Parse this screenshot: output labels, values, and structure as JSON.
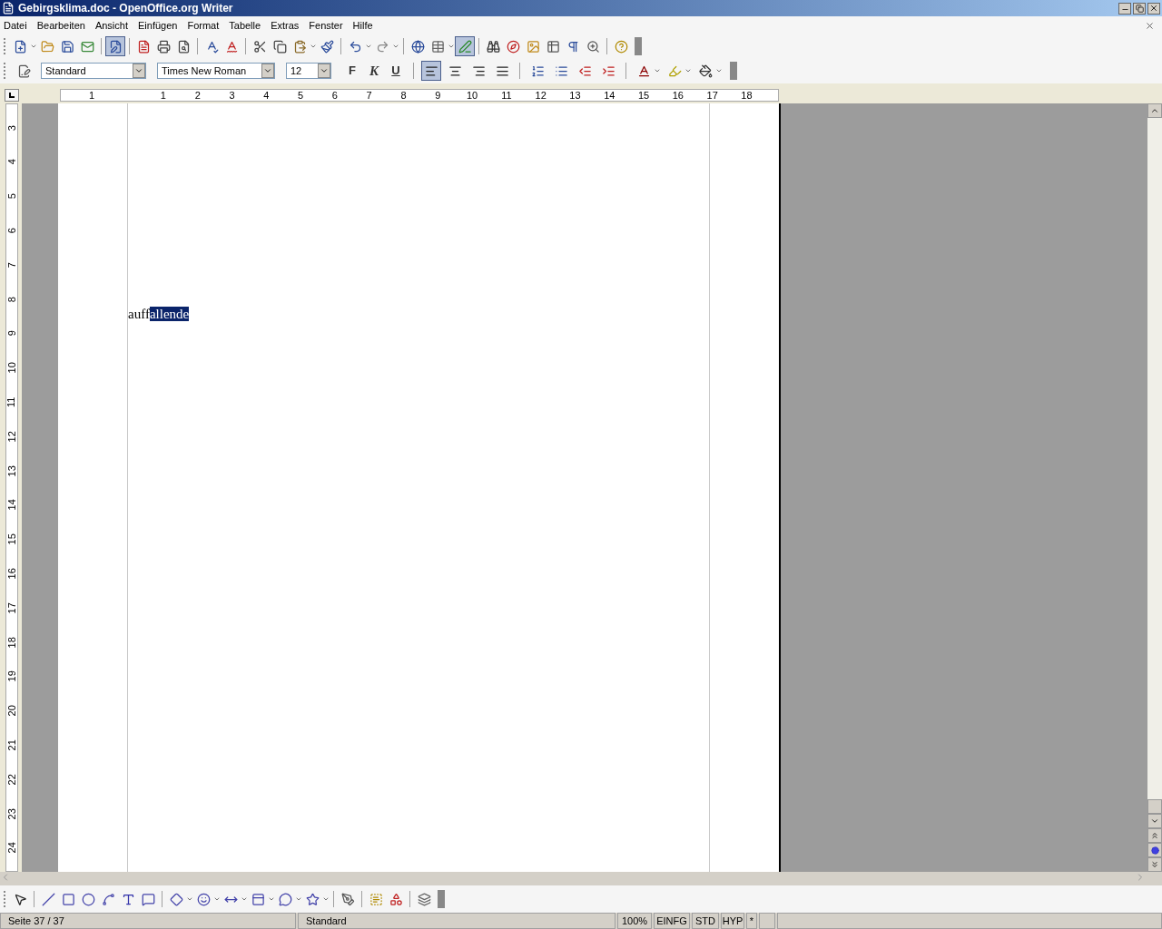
{
  "window": {
    "title": "Gebirgsklima.doc - OpenOffice.org Writer"
  },
  "menu": [
    "Datei",
    "Bearbeiten",
    "Ansicht",
    "Einfügen",
    "Format",
    "Tabelle",
    "Extras",
    "Fenster",
    "Hilfe"
  ],
  "standard_toolbar": {
    "edit_mode_on": true,
    "draw_functions_on": true
  },
  "formatting": {
    "paragraph_style": "Standard",
    "font": "Times New Roman",
    "size": "12",
    "bold": "F",
    "italic": "K",
    "underline": "U",
    "alignment": [
      {
        "selected": true
      },
      {
        "selected": false
      },
      {
        "selected": false
      },
      {
        "selected": false
      }
    ]
  },
  "ruler": {
    "left_label": "1",
    "labels": [
      "1",
      "2",
      "3",
      "4",
      "5",
      "6",
      "7",
      "8",
      "9",
      "10",
      "11",
      "12",
      "13",
      "14",
      "15",
      "16",
      "17",
      "18"
    ]
  },
  "vertical_ruler": {
    "labels": [
      "3",
      "4",
      "5",
      "6",
      "7",
      "8",
      "9",
      "10",
      "11",
      "12",
      "13",
      "14",
      "15",
      "16",
      "17",
      "18",
      "19",
      "20",
      "21",
      "22",
      "23",
      "24"
    ]
  },
  "document": {
    "runs": [
      {
        "text": "auff",
        "selected": false
      },
      {
        "text": "allende",
        "selected": true
      }
    ]
  },
  "status_bar": {
    "page": "Seite 37 / 37",
    "page_style": "Standard",
    "zoom": "100%",
    "insert_mode": "EINFG",
    "selection_mode": "STD",
    "hyperlink_mode": "HYP",
    "modified": "*"
  }
}
